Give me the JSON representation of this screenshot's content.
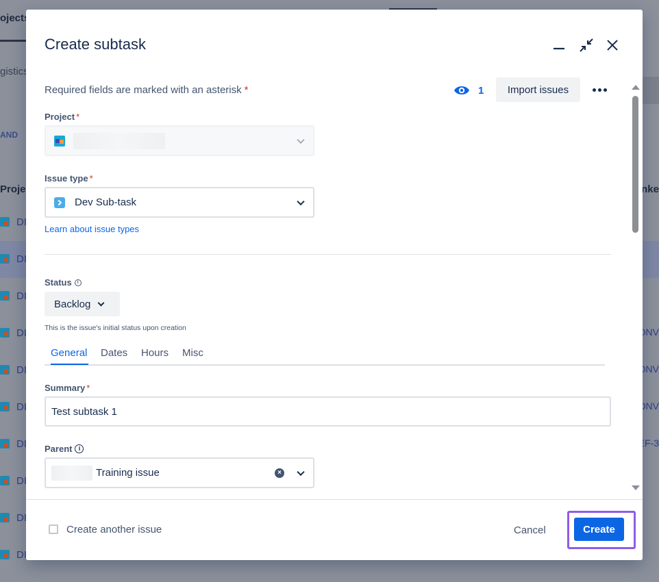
{
  "background": {
    "tab_label": "ojects",
    "subtitle": "gistics",
    "filter_text": "AND",
    "table_header_left": "Projec",
    "table_header_right": "nke",
    "row_key": "DI",
    "right_values": [
      "DNV",
      "DNV",
      "DNV",
      "EF-3"
    ]
  },
  "modal": {
    "title": "Create subtask",
    "required_note": "Required fields are marked with an asterisk",
    "asterisk": "*",
    "watchers_count": "1",
    "import_label": "Import issues",
    "project": {
      "label": "Project"
    },
    "issue_type": {
      "label": "Issue type",
      "value": "Dev Sub-task",
      "learn_link": "Learn about issue types"
    },
    "status": {
      "label": "Status",
      "value": "Backlog",
      "helper": "This is the issue's initial status upon creation"
    },
    "tabs": [
      "General",
      "Dates",
      "Hours",
      "Misc"
    ],
    "summary": {
      "label": "Summary",
      "value": "Test subtask 1"
    },
    "parent": {
      "label": "Parent",
      "value": "Training issue"
    },
    "footer": {
      "checkbox_label": "Create another issue",
      "cancel_label": "Cancel",
      "create_label": "Create"
    }
  },
  "colors": {
    "primary": "#0c66e4",
    "highlight_outline": "#8f5ce8",
    "required": "#c9372c"
  }
}
